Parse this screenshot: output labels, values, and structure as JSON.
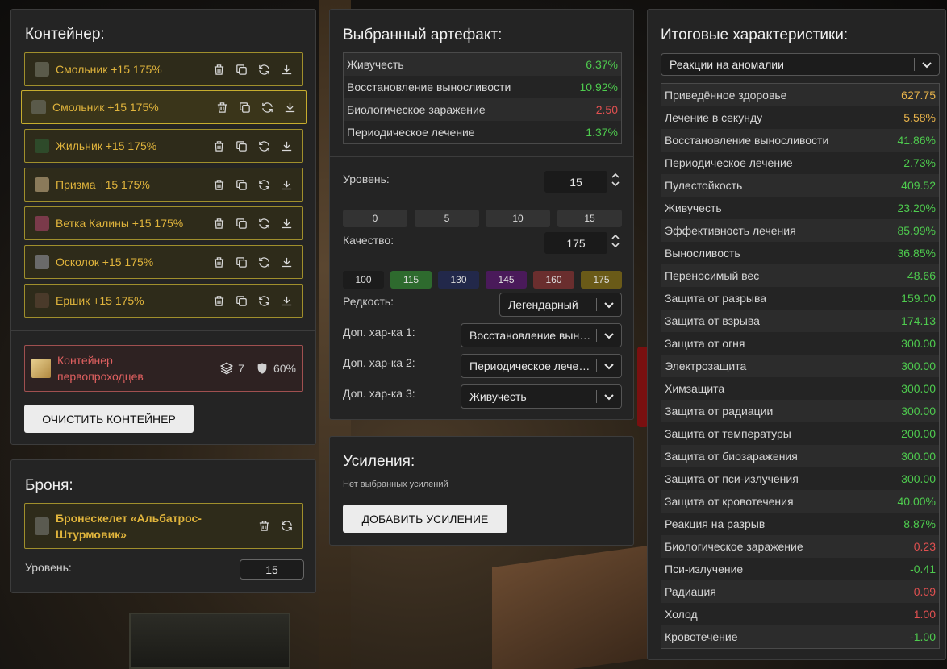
{
  "container": {
    "title": "Контейнер:",
    "items": [
      {
        "label": "Смольник +15 175%",
        "color": "#5a5a4a"
      },
      {
        "label": "Смольник +15 175%",
        "color": "#5a5a4a"
      },
      {
        "label": "Жильник +15 175%",
        "color": "#2e4a2a"
      },
      {
        "label": "Призма +15 175%",
        "color": "#8a7a5a"
      },
      {
        "label": "Ветка Калины +15 175%",
        "color": "#7a3a4a"
      },
      {
        "label": "Осколок +15 175%",
        "color": "#6a6a6a"
      },
      {
        "label": "Ершик +15 175%",
        "color": "#4a3a2a"
      }
    ],
    "info": {
      "name": "Контейнер первопроходцев",
      "slots": "7",
      "protection": "60%"
    },
    "clear_label": "ОЧИСТИТЬ КОНТЕЙНЕР"
  },
  "armor": {
    "title": "Броня:",
    "name": "Бронескелет «Альбатрос-Штурмовик»",
    "level_label": "Уровень:",
    "level": "15"
  },
  "artifact": {
    "title": "Выбранный артефакт:",
    "stats": [
      {
        "name": "Живучесть",
        "value": "6.37%",
        "tone": "g"
      },
      {
        "name": "Восстановление выносливости",
        "value": "10.92%",
        "tone": "g"
      },
      {
        "name": "Биологическое заражение",
        "value": "2.50",
        "tone": "r"
      },
      {
        "name": "Периодическое лечение",
        "value": "1.37%",
        "tone": "g"
      }
    ],
    "level_label": "Уровень:",
    "level": "15",
    "level_presets": [
      "0",
      "5",
      "10",
      "15"
    ],
    "quality_label": "Качество:",
    "quality": "175",
    "quality_presets": [
      {
        "v": "100",
        "c": "#1c1c1c"
      },
      {
        "v": "115",
        "c": "#2e6a2e"
      },
      {
        "v": "130",
        "c": "#22284a"
      },
      {
        "v": "145",
        "c": "#4a1a5a"
      },
      {
        "v": "160",
        "c": "#6a2e2e"
      },
      {
        "v": "175",
        "c": "#6a5a18"
      }
    ],
    "rarity_label": "Редкость:",
    "rarity": "Легендарный",
    "extra1_label": "Доп. хар-ка 1:",
    "extra1": "Восстановление выносливости",
    "extra2_label": "Доп. хар-ка 2:",
    "extra2": "Периодическое лечение",
    "extra3_label": "Доп. хар-ка 3:",
    "extra3": "Живучесть"
  },
  "boosts": {
    "title": "Усиления:",
    "empty": "Нет выбранных усилений",
    "add_label": "ДОБАВИТЬ УСИЛЕНИЕ"
  },
  "totals": {
    "title": "Итоговые характеристики:",
    "filter": "Реакции на аномалии",
    "stats": [
      {
        "name": "Приведённое здоровье",
        "value": "627.75",
        "tone": "o"
      },
      {
        "name": "Лечение в секунду",
        "value": "5.58%",
        "tone": "o"
      },
      {
        "name": "Восстановление выносливости",
        "value": "41.86%",
        "tone": "g"
      },
      {
        "name": "Периодическое лечение",
        "value": "2.73%",
        "tone": "g"
      },
      {
        "name": "Пулестойкость",
        "value": "409.52",
        "tone": "g"
      },
      {
        "name": "Живучесть",
        "value": "23.20%",
        "tone": "g"
      },
      {
        "name": "Эффективность лечения",
        "value": "85.99%",
        "tone": "g"
      },
      {
        "name": "Выносливость",
        "value": "36.85%",
        "tone": "g"
      },
      {
        "name": "Переносимый вес",
        "value": "48.66",
        "tone": "g"
      },
      {
        "name": "Защита от разрыва",
        "value": "159.00",
        "tone": "g"
      },
      {
        "name": "Защита от взрыва",
        "value": "174.13",
        "tone": "g"
      },
      {
        "name": "Защита от огня",
        "value": "300.00",
        "tone": "g"
      },
      {
        "name": "Электрозащита",
        "value": "300.00",
        "tone": "g"
      },
      {
        "name": "Химзащита",
        "value": "300.00",
        "tone": "g"
      },
      {
        "name": "Защита от радиации",
        "value": "300.00",
        "tone": "g"
      },
      {
        "name": "Защита от температуры",
        "value": "200.00",
        "tone": "g"
      },
      {
        "name": "Защита от биозаражения",
        "value": "300.00",
        "tone": "g"
      },
      {
        "name": "Защита от пси-излучения",
        "value": "300.00",
        "tone": "g"
      },
      {
        "name": "Защита от кровотечения",
        "value": "40.00%",
        "tone": "g"
      },
      {
        "name": "Реакция на разрыв",
        "value": "8.87%",
        "tone": "g"
      },
      {
        "name": "Биологическое заражение",
        "value": "0.23",
        "tone": "r"
      },
      {
        "name": "Пси-излучение",
        "value": "-0.41",
        "tone": "g"
      },
      {
        "name": "Радиация",
        "value": "0.09",
        "tone": "r"
      },
      {
        "name": "Холод",
        "value": "1.00",
        "tone": "r"
      },
      {
        "name": "Кровотечение",
        "value": "-1.00",
        "tone": "g"
      }
    ]
  }
}
